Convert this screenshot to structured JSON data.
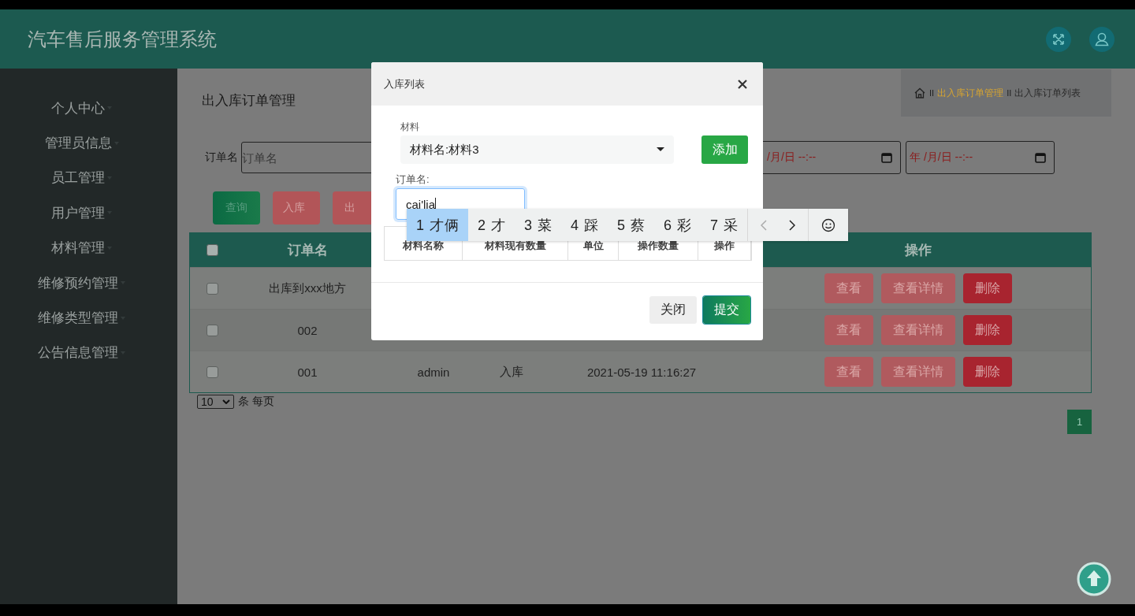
{
  "app": {
    "title": "汽车售后服务管理系统"
  },
  "sidebar": {
    "items": [
      {
        "label": "个人中心"
      },
      {
        "label": "管理员信息"
      },
      {
        "label": "员工管理"
      },
      {
        "label": "用户管理"
      },
      {
        "label": "材料管理"
      },
      {
        "label": "维修预约管理"
      },
      {
        "label": "维修类型管理"
      },
      {
        "label": "公告信息管理"
      }
    ]
  },
  "page_title": "出入库订单管理",
  "breadcrumb": [
    {
      "separator": "II",
      "label": "出入库订单管理",
      "kind": "link"
    },
    {
      "separator": "II",
      "label": "出入库订单列表",
      "kind": "current"
    }
  ],
  "search": {
    "label": "订单名",
    "placeholder": "订单名",
    "date_fields": [
      {
        "placeholder": "/月/日 --:--"
      },
      {
        "placeholder": "年 /月/日 --:--"
      }
    ]
  },
  "actions": [
    {
      "label": "查询",
      "kind": "primary"
    },
    {
      "label": "入库",
      "kind": "danger"
    },
    {
      "label": "出",
      "kind": "danger"
    }
  ],
  "table": {
    "header_checked": false,
    "columns": [
      "订单名",
      null,
      null,
      null,
      "操作"
    ],
    "rows": [
      {
        "checked": false,
        "cells": [
          "出库到xxx地方",
          null,
          null,
          null
        ],
        "actions": [
          {
            "label": "查看",
            "kind": "view"
          },
          {
            "label": "查看详情",
            "kind": "view"
          },
          {
            "label": "删除",
            "kind": "delete"
          }
        ]
      },
      {
        "checked": false,
        "cells": [
          "002",
          null,
          null,
          null
        ],
        "actions": [
          {
            "label": "查看",
            "kind": "view"
          },
          {
            "label": "查看详情",
            "kind": "view"
          },
          {
            "label": "删除",
            "kind": "delete"
          }
        ]
      },
      {
        "checked": false,
        "cells": [
          "001",
          "admin",
          "入库",
          "2021-05-19 11:16:27"
        ],
        "actions": [
          {
            "label": "查看",
            "kind": "view"
          },
          {
            "label": "查看详情",
            "kind": "view"
          },
          {
            "label": "删除",
            "kind": "delete"
          }
        ]
      }
    ]
  },
  "pagination": {
    "page_size": "10",
    "page_size_label": "条 每页",
    "pages": [
      {
        "label": "1",
        "selected": true
      }
    ]
  },
  "modal": {
    "title": "入库列表",
    "material_label": "材料",
    "material_value": "材料名:材料3",
    "add_button": "添加",
    "order_label": "订单名:",
    "order_value": "cai'lia",
    "columns": [
      "材料名称",
      "材料现有数量",
      "单位",
      "操作数量",
      "操作"
    ],
    "buttons": [
      {
        "label": "关闭",
        "kind": "secondary"
      },
      {
        "label": "提交",
        "kind": "primary"
      }
    ]
  },
  "ime": {
    "candidates": [
      {
        "index": "1",
        "text": "才俩",
        "selected": true
      },
      {
        "index": "2",
        "text": "才",
        "selected": false
      },
      {
        "index": "3",
        "text": "菜",
        "selected": false
      },
      {
        "index": "4",
        "text": "踩",
        "selected": false
      },
      {
        "index": "5",
        "text": "蔡",
        "selected": false
      },
      {
        "index": "6",
        "text": "彩",
        "selected": false
      },
      {
        "index": "7",
        "text": "采",
        "selected": false
      }
    ],
    "prev_disabled": true,
    "next_disabled": false
  }
}
